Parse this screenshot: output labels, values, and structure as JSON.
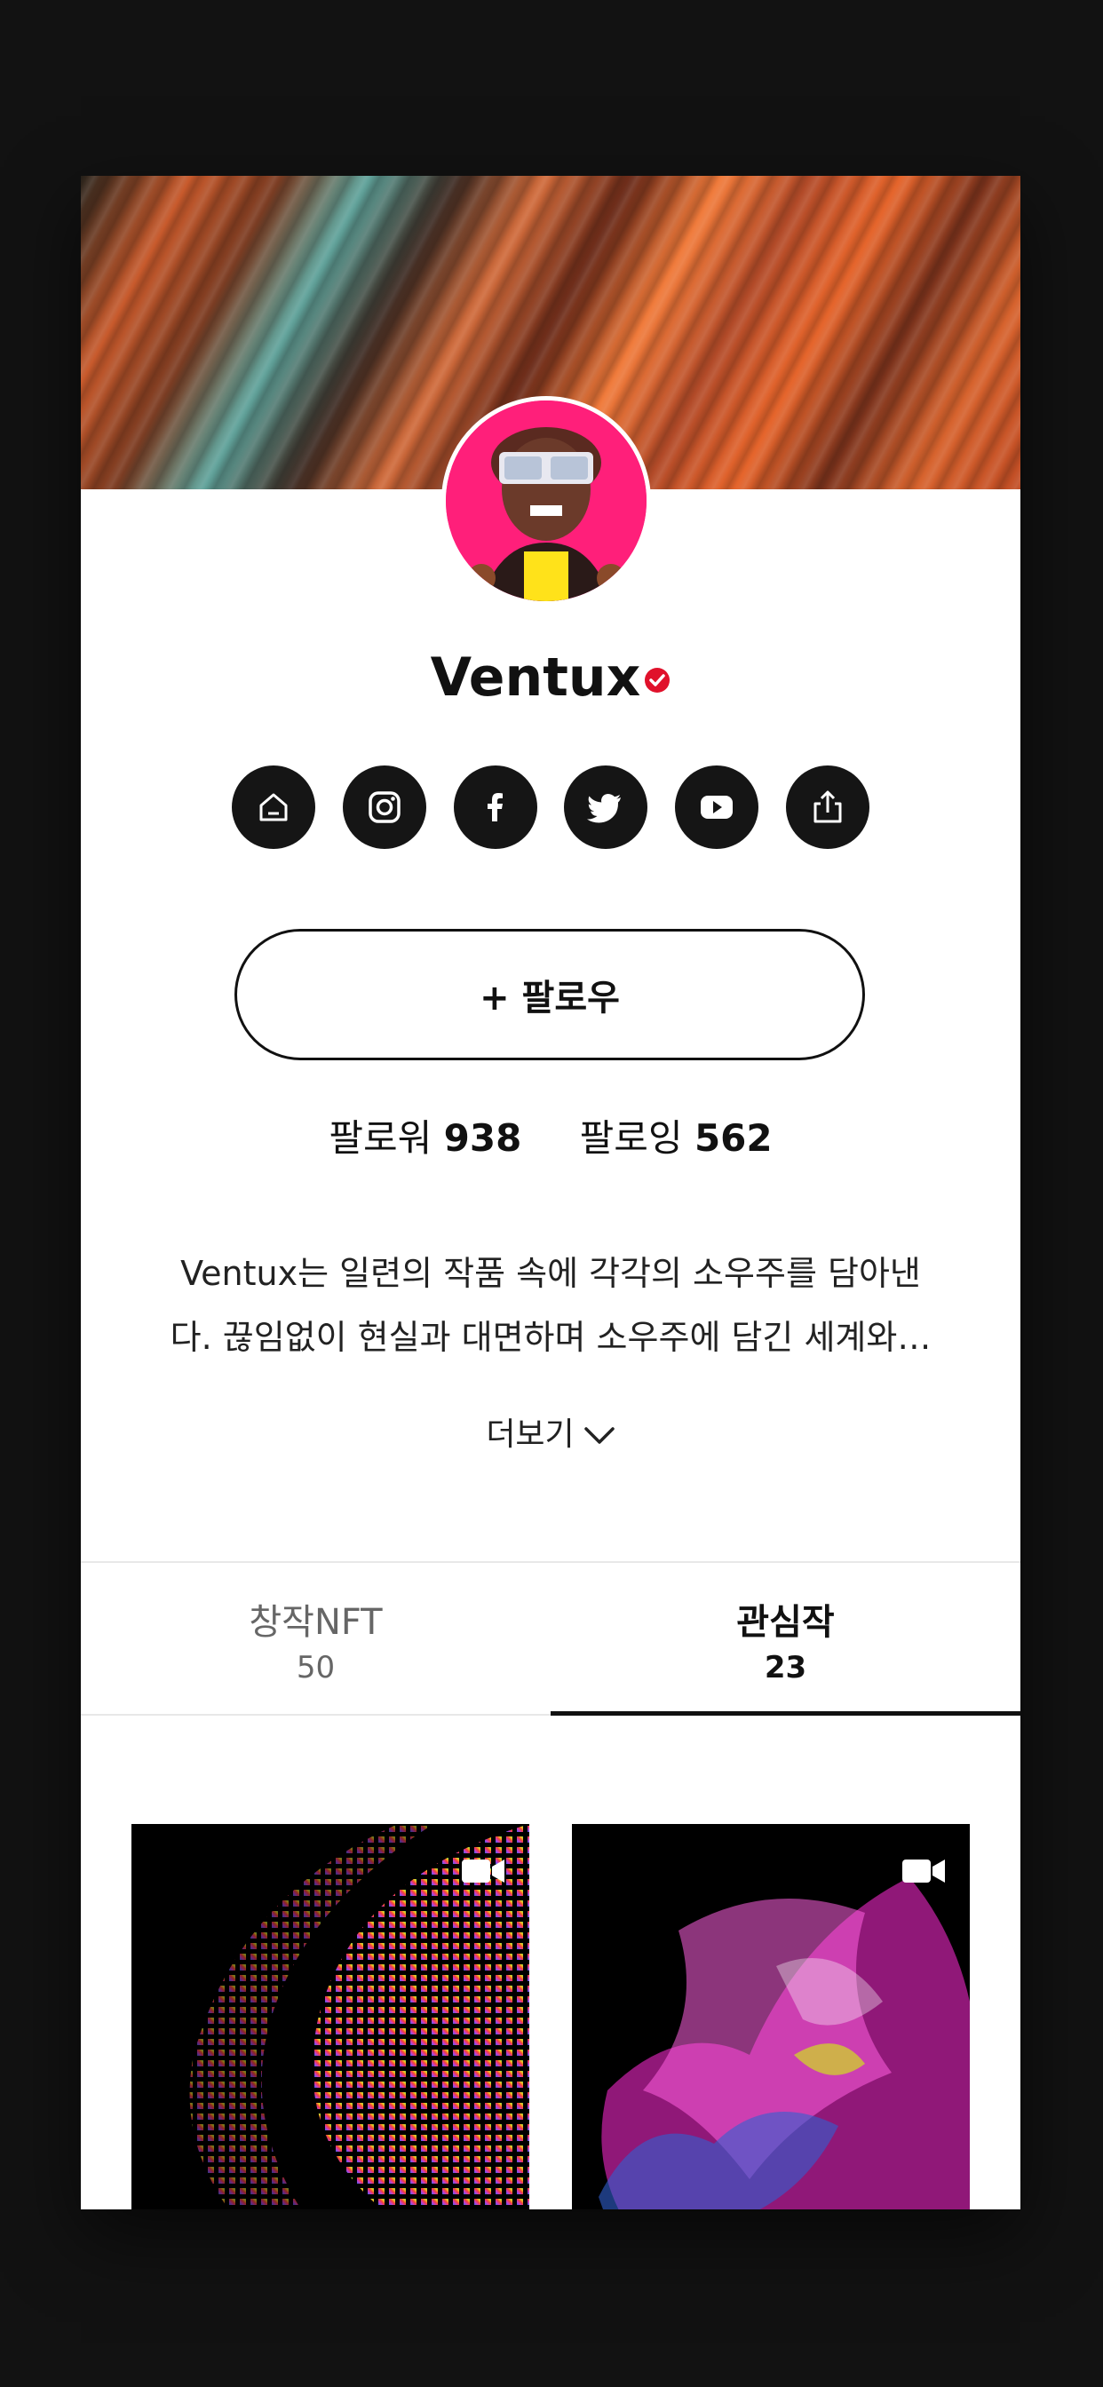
{
  "profile": {
    "name": "Ventux",
    "verified_color": "#e0112b"
  },
  "socials": [
    {
      "icon": "home-icon"
    },
    {
      "icon": "instagram-icon"
    },
    {
      "icon": "facebook-icon"
    },
    {
      "icon": "twitter-icon"
    },
    {
      "icon": "youtube-icon"
    },
    {
      "icon": "share-icon"
    }
  ],
  "follow_button": {
    "label": "+ 팔로우"
  },
  "stats": {
    "followers_label": "팔로워",
    "followers_count": "938",
    "following_label": "팔로잉",
    "following_count": "562"
  },
  "bio": {
    "line1": "Ventux는 일련의 작품 속에 각각의 소우주를 담아낸",
    "line2": "다. 끊임없이 현실과 대면하며 소우주에 담긴 세계와…"
  },
  "more_label": "더보기",
  "tabs": [
    {
      "label": "창작NFT",
      "count": "50",
      "active": false
    },
    {
      "label": "관심작",
      "count": "23",
      "active": true
    }
  ],
  "cards": [
    {
      "type": "video",
      "icon": "video-camera-icon"
    },
    {
      "type": "video",
      "icon": "video-camera-icon"
    }
  ]
}
